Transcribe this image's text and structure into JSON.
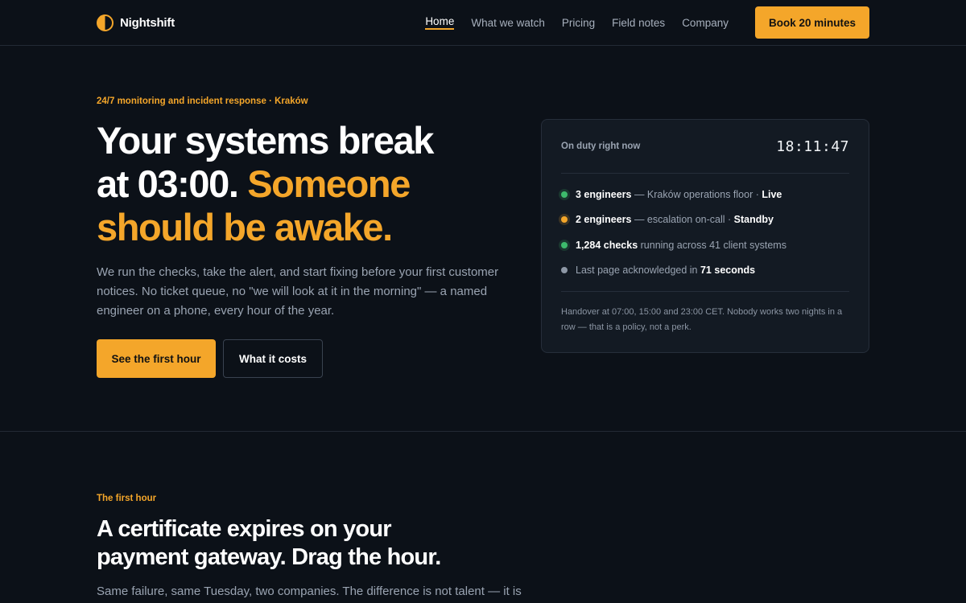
{
  "nav": {
    "brand": "Nightshift",
    "links": [
      "Home",
      "What we watch",
      "Pricing",
      "Field notes",
      "Company"
    ],
    "cta": "Book 20 minutes"
  },
  "hero": {
    "eyebrow": "24/7 monitoring and incident response · Kraków",
    "title_line1": "Your systems break",
    "title_line2a": "at 03:00.",
    "title_accent1": "Someone",
    "title_accent2": "should be awake.",
    "subtitle": "We run the checks, take the alert, and start fixing before your first customer notices. No ticket queue, no \"we will look at it in the morning\" — a named engineer on a phone, every hour of the year.",
    "primary_cta": "See the first hour",
    "secondary_cta": "What it costs"
  },
  "duty": {
    "label": "On duty right now",
    "clock": "18:11:47",
    "rows": [
      {
        "bold": "3 engineers",
        "text": " — Kraków operations floor · ",
        "bold2": "Live",
        "status": "green"
      },
      {
        "bold": "2 engineers",
        "text": " — escalation on-call · ",
        "bold2": "Standby",
        "status": "amber"
      },
      {
        "bold": "1,284 checks",
        "text": " running across 41 client systems",
        "bold2": "",
        "status": "green"
      },
      {
        "pre": "Last page acknowledged in ",
        "bold": "71 seconds",
        "status": "gray"
      }
    ],
    "footer": "Handover at 07:00, 15:00 and 23:00 CET. Nobody works two nights in a row — that is a policy, not a perk."
  },
  "section": {
    "eyebrow": "The first hour",
    "title_line1": "A certificate expires on your",
    "title_line2": "payment gateway. Drag the hour.",
    "subtitle": "Same failure, same Tuesday, two companies. The difference is not talent — it is"
  },
  "colors": {
    "accent": "#f4a62a",
    "background": "#0c1118",
    "live": "#3dbb6c"
  }
}
